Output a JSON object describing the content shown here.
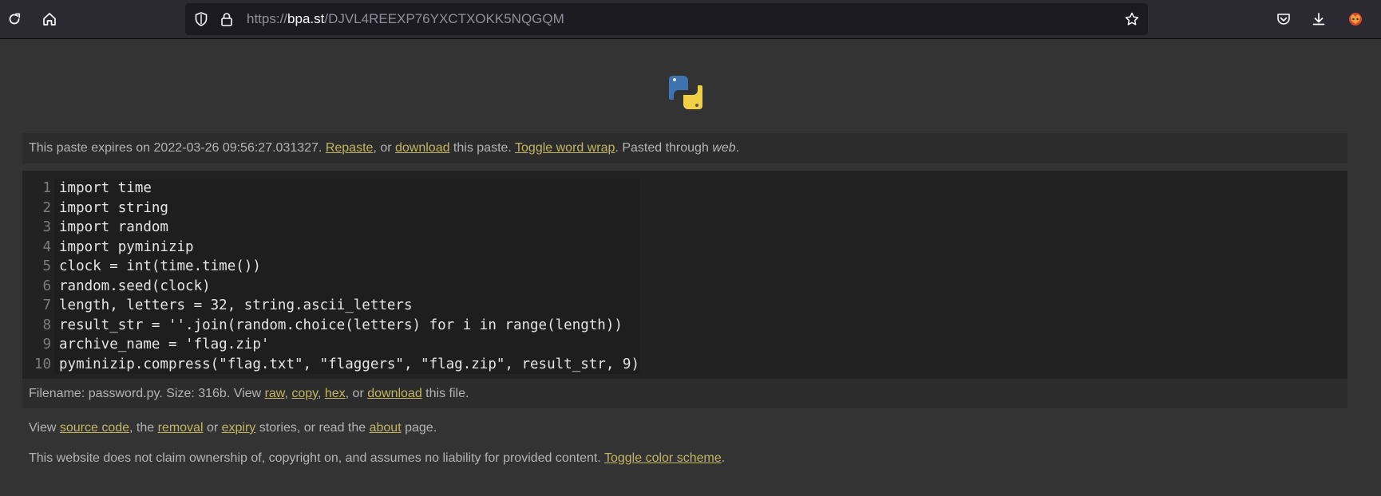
{
  "browser": {
    "url_scheme": "https://",
    "url_host": "bpa.st",
    "url_path": "/DJVL4REEXP76YXCTXOKK5NQGQM"
  },
  "meta": {
    "prefix": "This paste expires on 2022-03-26 09:56:27.031327. ",
    "repaste": "Repaste",
    "or": ", or ",
    "download": "download",
    "this_paste": " this paste. ",
    "toggle_wrap": "Toggle word wrap",
    "pasted_through": ". Pasted through ",
    "source": "web",
    "end": "."
  },
  "code": {
    "line_numbers": [
      "1",
      "2",
      "3",
      "4",
      "5",
      "6",
      "7",
      "8",
      "9",
      "10"
    ],
    "lines": [
      "import time",
      "import string",
      "import random",
      "import pyminizip",
      "clock = int(time.time())",
      "random.seed(clock)",
      "length, letters = 32, string.ascii_letters",
      "result_str = ''.join(random.choice(letters) for i in range(length))",
      "archive_name = 'flag.zip'",
      "pyminizip.compress(\"flag.txt\", \"flaggers\", \"flag.zip\", result_str, 9)"
    ]
  },
  "file": {
    "prefix": "Filename: password.py. Size: 316b. View ",
    "raw": "raw",
    "sep1": ", ",
    "copy": "copy",
    "sep2": ", ",
    "hex": "hex",
    "or": ", or ",
    "download": "download",
    "suffix": " this file."
  },
  "footer": {
    "view": "View ",
    "source_code": "source code",
    "the": ", the ",
    "removal": "removal",
    "or": " or ",
    "expiry": "expiry",
    "stories": " stories, or read the ",
    "about": "about",
    "page": " page.",
    "disclaimer": "This website does not claim ownership of, copyright on, and assumes no liability for provided content. ",
    "toggle_scheme": "Toggle color scheme",
    "end": "."
  }
}
